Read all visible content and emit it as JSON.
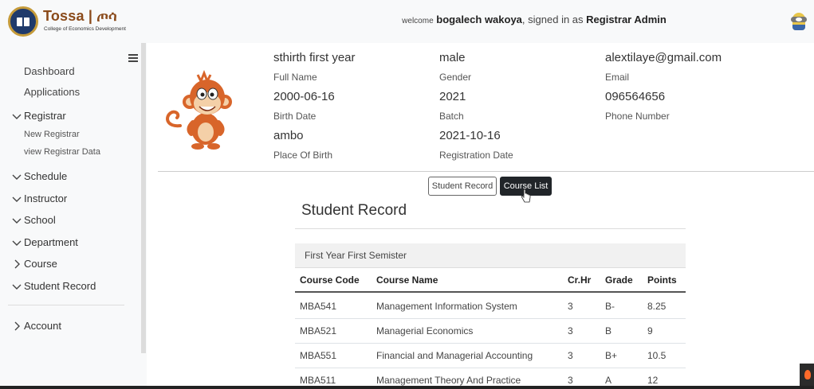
{
  "header": {
    "brand_title": "Tossa | ጦሳ",
    "brand_subtitle": "College of Economics Development",
    "welcome_prefix": "welcome",
    "user_name": "bogalech wakoya",
    "signed_in_text": ", signed in as",
    "role": "Registrar Admin"
  },
  "sidebar": {
    "dashboard": "Dashboard",
    "applications": "Applications",
    "registrar": "Registrar",
    "new_registrar": "New Registrar",
    "view_registrar_data": "view Registrar Data",
    "schedule": "Schedule",
    "instructor": "Instructor",
    "school": "School",
    "department": "Department",
    "course": "Course",
    "student_record": "Student Record",
    "account": "Account"
  },
  "profile": {
    "full_name": "sthirth first year",
    "full_name_label": "Full Name",
    "gender": "male",
    "gender_label": "Gender",
    "email": "alextilaye@gmail.com",
    "email_label": "Email",
    "birth_date": "2000-06-16",
    "birth_date_label": "Birth Date",
    "batch": "2021",
    "batch_label": "Batch",
    "phone": "096564656",
    "phone_label": "Phone Number",
    "place_of_birth": "ambo",
    "place_of_birth_label": "Place Of Birth",
    "registration_date": "2021-10-16",
    "registration_date_label": "Registration Date"
  },
  "buttons": {
    "student_record": "Student Record",
    "course_list": "Course List"
  },
  "record": {
    "title": "Student Record",
    "semester": "First Year First Semister",
    "columns": [
      "Course Code",
      "Course Name",
      "Cr.Hr",
      "Grade",
      "Points"
    ],
    "rows": [
      [
        "MBA541",
        "Management Information System",
        "3",
        "B-",
        "8.25"
      ],
      [
        "MBA521",
        "Managerial Economics",
        "3",
        "B",
        "9"
      ],
      [
        "MBA551",
        "Financial and Managerial Accounting",
        "3",
        "B+",
        "10.5"
      ],
      [
        "MBA511",
        "Management Theory And Practice",
        "3",
        "A",
        "12"
      ]
    ]
  },
  "colors": {
    "brand": "#8a4a1a",
    "dark_button": "#212529",
    "logo_ring": "#c59b3a"
  }
}
